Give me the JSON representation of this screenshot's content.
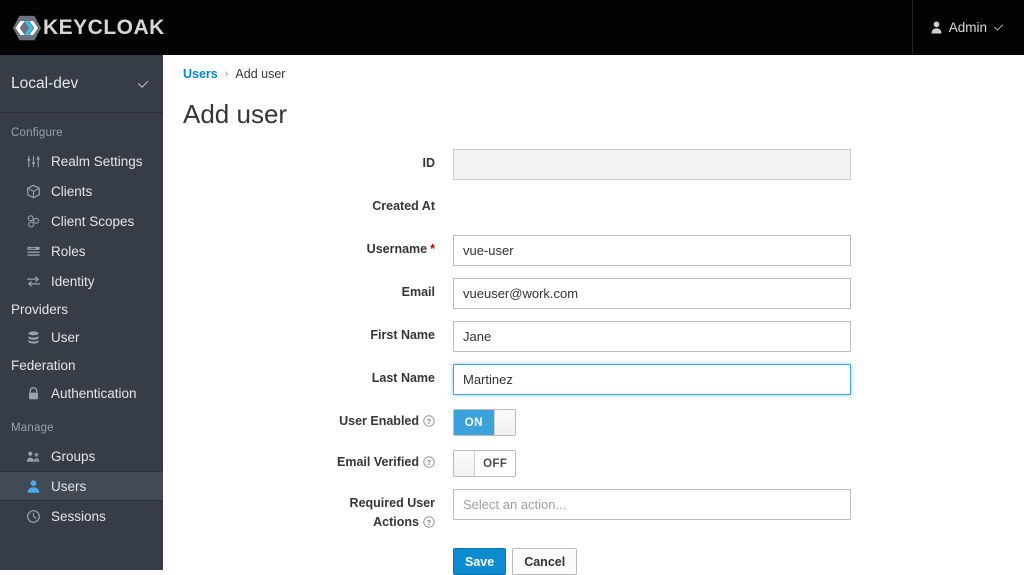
{
  "masthead": {
    "brand_name": "KEYCLOAK",
    "brand_logo_icon": "keycloak-hexagon-logo",
    "user_icon": "user-icon",
    "user_name": "Admin",
    "caret_icon": "chevron-down-icon"
  },
  "sidebar": {
    "realm": {
      "name": "Local-dev",
      "caret_icon": "chevron-down-icon"
    },
    "sections": [
      {
        "title": "Configure",
        "items": [
          {
            "label": "Realm Settings",
            "icon": "sliders-icon",
            "active": false,
            "continuation": null
          },
          {
            "label": "Clients",
            "icon": "cube-icon",
            "active": false,
            "continuation": null
          },
          {
            "label": "Client Scopes",
            "icon": "blocks-icon",
            "active": false,
            "continuation": null
          },
          {
            "label": "Roles",
            "icon": "list-icon",
            "active": false,
            "continuation": null
          },
          {
            "label": "Identity",
            "icon": "exchange-arrows-icon",
            "active": false,
            "continuation": "Providers"
          },
          {
            "label": "User",
            "icon": "database-icon",
            "active": false,
            "continuation": "Federation"
          },
          {
            "label": "Authentication",
            "icon": "lock-icon",
            "active": false,
            "continuation": null
          }
        ]
      },
      {
        "title": "Manage",
        "items": [
          {
            "label": "Groups",
            "icon": "users-group-icon",
            "active": false,
            "continuation": null
          },
          {
            "label": "Users",
            "icon": "user-icon",
            "active": true,
            "continuation": null
          },
          {
            "label": "Sessions",
            "icon": "clock-icon",
            "active": false,
            "continuation": null
          }
        ]
      }
    ]
  },
  "main": {
    "breadcrumb": {
      "parent": "Users",
      "separator": "›",
      "current": "Add user"
    },
    "page_title": "Add user",
    "form": {
      "fields": [
        {
          "label": "ID",
          "type": "text",
          "value": "",
          "placeholder": "",
          "disabled": true,
          "required": false,
          "help": false
        },
        {
          "label": "Created At",
          "type": "static",
          "value": "",
          "placeholder": "",
          "disabled": false,
          "required": false,
          "help": false
        },
        {
          "label": "Username",
          "type": "text",
          "value": "vue-user",
          "placeholder": "",
          "disabled": false,
          "required": true,
          "help": false
        },
        {
          "label": "Email",
          "type": "text",
          "value": "vueuser@work.com",
          "placeholder": "",
          "disabled": false,
          "required": false,
          "help": false
        },
        {
          "label": "First Name",
          "type": "text",
          "value": "Jane",
          "placeholder": "",
          "disabled": false,
          "required": false,
          "help": false
        },
        {
          "label": "Last Name",
          "type": "text",
          "value": "Martinez",
          "placeholder": "",
          "disabled": false,
          "required": false,
          "help": false,
          "focused": true
        },
        {
          "label": "User Enabled",
          "type": "toggle",
          "state": "ON",
          "on_label": "ON",
          "off_label": "OFF",
          "help": true
        },
        {
          "label": "Email Verified",
          "type": "toggle",
          "state": "OFF",
          "on_label": "ON",
          "off_label": "OFF",
          "help": true
        },
        {
          "label": "Required User Actions",
          "label_line1": "Required User",
          "label_line2": "Actions",
          "type": "select",
          "value": "",
          "placeholder": "Select an action...",
          "help": true
        }
      ],
      "buttons": {
        "save_label": "Save",
        "cancel_label": "Cancel"
      }
    }
  },
  "colors": {
    "masthead_bg": "#030303",
    "sidebar_bg": "#363d47",
    "sidebar_active_bg": "#424a55",
    "accent_blue": "#0088ce",
    "toggle_on": "#3aa2dd",
    "required_red": "#cc0000",
    "link_blue": "#0088ce"
  }
}
